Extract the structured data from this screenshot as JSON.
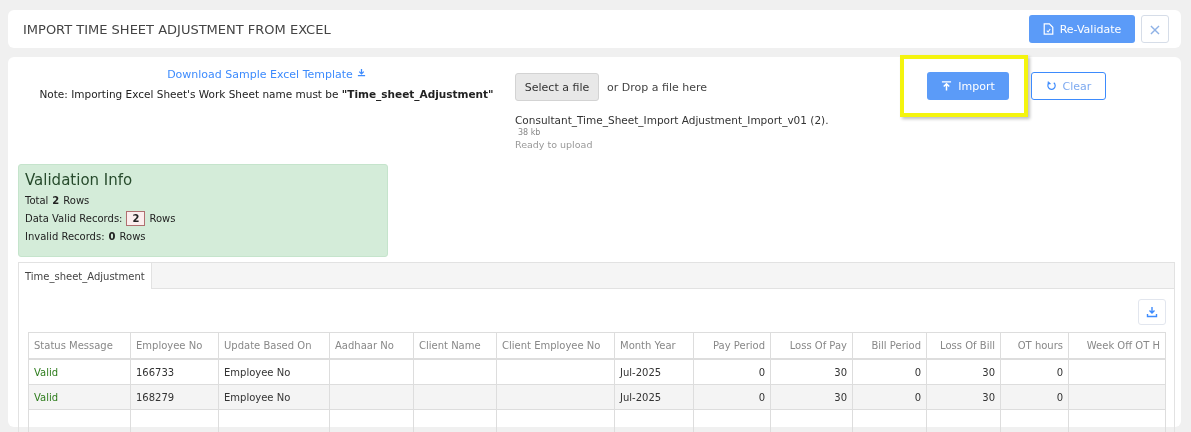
{
  "header": {
    "title": "IMPORT TIME SHEET ADJUSTMENT FROM EXCEL",
    "revalidate_button": "Re-Validate",
    "close_button": "×"
  },
  "template": {
    "download_link": "Download Sample Excel Template",
    "note": "Note: Importing Excel Sheet's Work Sheet name must be **\"Time_sheet_Adjustment\"**"
  },
  "upload": {
    "select_button": "Select a file",
    "drop_hint": "or Drop a file here",
    "file_name": "Consultant_Time_Sheet_Import Adjustment_Import_v01 (2).",
    "file_size": "38 kb",
    "status": "Ready to upload"
  },
  "actions": {
    "import_button": "Import",
    "import_highlighted": true,
    "clear_button": "Clear"
  },
  "validation": {
    "title": "Validation Info",
    "total_label": "Total",
    "total": "2",
    "total_unit": "Rows",
    "valid_label": "Data Valid Records:",
    "valid": "2",
    "valid_unit": "Rows",
    "invalid_label": "Invalid Records:",
    "invalid": "0",
    "invalid_unit": "Rows"
  },
  "tabs": [
    {
      "label": "Time_sheet_Adjustment",
      "selected": true
    }
  ],
  "table": {
    "columns": [
      "Status Message",
      "Employee No",
      "Update Based On",
      "Aadhaar No",
      "Client Name",
      "Client Employee No",
      "Month Year",
      "Pay Period",
      "Loss Of Pay",
      "Bill Period",
      "Loss Of Bill",
      "OT hours",
      "Week Off OT H"
    ],
    "rows": [
      [
        "Valid",
        "166733",
        "Employee No",
        "",
        "",
        "",
        "Jul-2025",
        "0",
        "30",
        "0",
        "30",
        "0",
        ""
      ],
      [
        "Valid",
        "168279",
        "Employee No",
        "",
        "",
        "",
        "Jul-2025",
        "0",
        "30",
        "0",
        "30",
        "0",
        ""
      ]
    ]
  }
}
